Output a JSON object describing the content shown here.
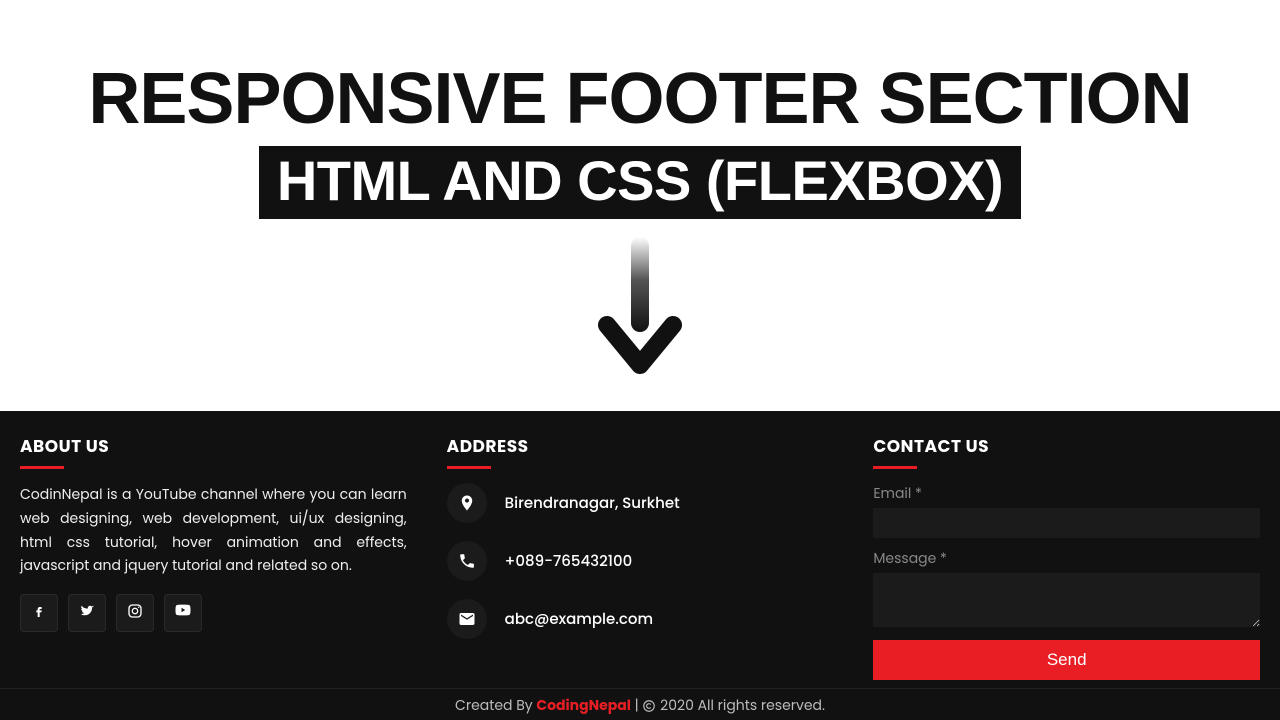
{
  "hero": {
    "title": "RESPONSIVE FOOTER SECTION",
    "subtitle": "HTML AND CSS (FLEXBOX)"
  },
  "footer": {
    "about": {
      "heading": "ABOUT US",
      "body": "CodinNepal is a YouTube channel where you can learn web designing, web development, ui/ux designing, html css tutorial, hover animation and effects, javascript and jquery tutorial and related so on."
    },
    "address": {
      "heading": "ADDRESS",
      "location": "Birendranagar, Surkhet",
      "phone": "+089-765432100",
      "email": "abc@example.com"
    },
    "contact": {
      "heading": "CONTACT US",
      "email_label": "Email *",
      "message_label": "Message *",
      "send_label": "Send"
    },
    "bottom": {
      "prefix": "Created By ",
      "brand": "CodingNepal",
      "sep": " | ",
      "rights": " 2020 All rights reserved."
    },
    "social_icons": [
      "facebook-icon",
      "twitter-icon",
      "instagram-icon",
      "youtube-icon"
    ]
  }
}
